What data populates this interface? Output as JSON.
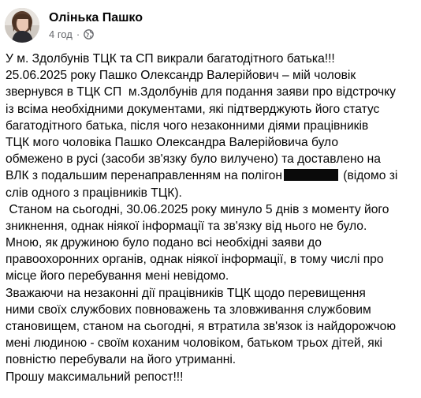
{
  "post": {
    "author": "Олінька Пашко",
    "time": "4 год",
    "separator": "·",
    "privacy_icon": "globe-icon",
    "lines": [
      "У м. Здолбунів ТЦК та СП викрали багатодітного батька!!!",
      "25.06.2025 року Пашко Олександр Валерійович – мій чоловік",
      "звернувся в ТЦК СП  м.Здолбунів для подання заяви про відстрочку",
      "із всіма необхідними документами, які підтверджують його статус",
      "багатодітного батька, після чого незаконними діями працівників",
      "ТЦК мого чоловіка Пашко Олександра Валерійовича було",
      "обмежено в русі (засоби зв'язку було вилучено) та доставлено на",
      "ВЛК з подальшим перенаправленням на полігон",
      "слів одного з працівників ТЦК).",
      " Станом на сьогодні, 30.06.2025 року минуло 5 днів з моменту його",
      "зникнення, однак ніякої інформації та зв'язку від нього не було.",
      "Мною, як дружиною було подано всі необхідні заяви до",
      "правоохоронних органів, однак ніякої інформації, в тому числі про",
      "місце його перебування мені невідомо.",
      "Зважаючи на незаконні дії працівників ТЦК щодо перевищення",
      "ними своїх службових повноважень та зловживання службовим",
      "становищем, станом на сьогодні, я втратила зв'язок із найдорожчою",
      "мені людиною - своїм коханим чоловіком, батьком трьох дітей, які",
      "повністю перебували на його утриманні.",
      "Прошу максимальний репост!!!"
    ],
    "line_after_redaction": " (відомо зі"
  }
}
